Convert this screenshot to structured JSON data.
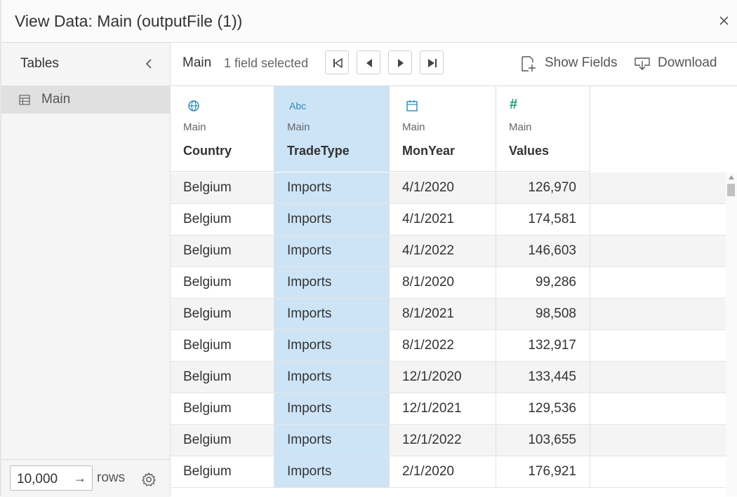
{
  "dialog": {
    "title": "View Data: Main (outputFile (1))"
  },
  "sidebar": {
    "title": "Tables",
    "items": [
      {
        "label": "Main",
        "icon": "table-icon"
      }
    ],
    "rows_value": "10,000",
    "rows_go": "→",
    "rows_label": "rows"
  },
  "toolbar": {
    "table_name": "Main",
    "selection_status": "1 field selected",
    "show_fields_label": "Show Fields",
    "download_label": "Download"
  },
  "columns": [
    {
      "icon": "⊕",
      "source": "Main",
      "name": "Country",
      "type": "geographic",
      "selected": false
    },
    {
      "icon": "Abc",
      "source": "Main",
      "name": "TradeType",
      "type": "string",
      "selected": true
    },
    {
      "icon": "▦",
      "source": "Main",
      "name": "MonYear",
      "type": "date",
      "selected": false
    },
    {
      "icon": "#",
      "source": "Main",
      "name": "Values",
      "type": "number",
      "selected": false
    }
  ],
  "rows": [
    [
      "Belgium",
      "Imports",
      "4/1/2020",
      "126,970"
    ],
    [
      "Belgium",
      "Imports",
      "4/1/2021",
      "174,581"
    ],
    [
      "Belgium",
      "Imports",
      "4/1/2022",
      "146,603"
    ],
    [
      "Belgium",
      "Imports",
      "8/1/2020",
      "99,286"
    ],
    [
      "Belgium",
      "Imports",
      "8/1/2021",
      "98,508"
    ],
    [
      "Belgium",
      "Imports",
      "8/1/2022",
      "132,917"
    ],
    [
      "Belgium",
      "Imports",
      "12/1/2020",
      "133,445"
    ],
    [
      "Belgium",
      "Imports",
      "12/1/2021",
      "129,536"
    ],
    [
      "Belgium",
      "Imports",
      "12/1/2022",
      "103,655"
    ],
    [
      "Belgium",
      "Imports",
      "2/1/2020",
      "176,921"
    ]
  ],
  "colors": {
    "selected_column": "#cde4f7",
    "icon_blue": "#2a8ab8",
    "icon_green": "#1a9e6e"
  }
}
